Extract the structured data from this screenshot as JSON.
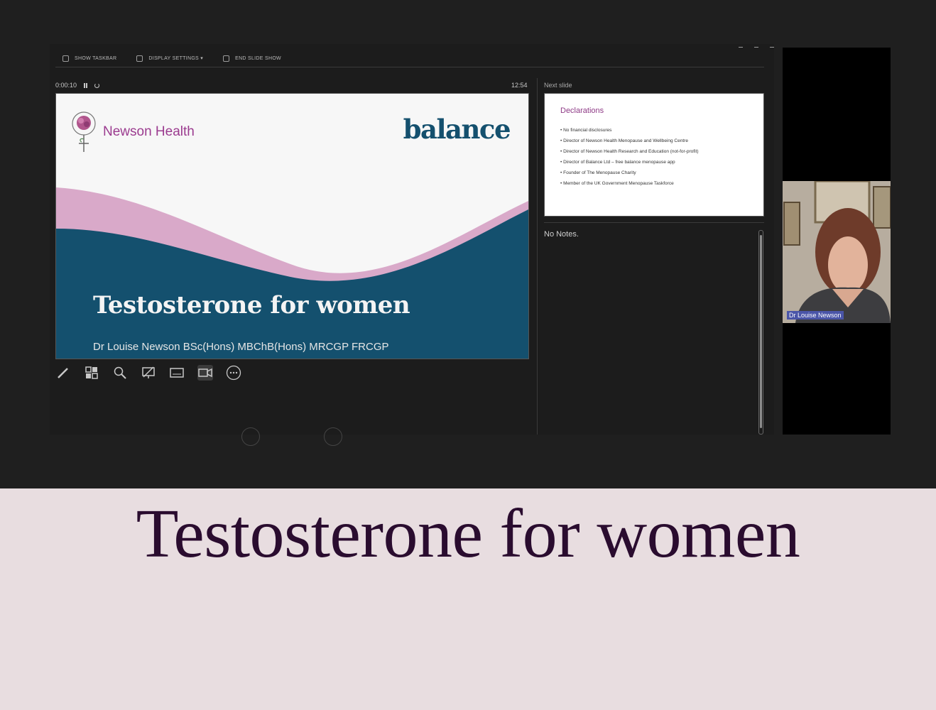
{
  "toolbar": {
    "items": [
      "SHOW TASKBAR",
      "DISPLAY SETTINGS ▾",
      "END SLIDE SHOW"
    ]
  },
  "timer": {
    "elapsed": "0:00:10",
    "clock": "12:54"
  },
  "current_slide": {
    "org_name": "Newson Health",
    "brand": "balance",
    "title": "Testosterone for women",
    "author": "Dr Louise Newson BSc(Hons) MBChB(Hons) MRCGP FRCGP"
  },
  "next_slide": {
    "label": "Next slide",
    "title": "Declarations",
    "items": [
      "No financial disclosures",
      "Director of Newson Health Menopause and Wellbeing Centre",
      "Director of Newson Health Research and Education (not-for-profit)",
      "Director of Balance Ltd – free balance menopause app",
      "Founder of The Menopause Charity",
      "Member of the UK Government Menopause Taskforce"
    ]
  },
  "notes": "No Notes.",
  "camera": {
    "name": "Dr Louise Newson"
  },
  "caption": "Testosterone for women",
  "colors": {
    "brand_purple": "#9b3b8f",
    "brand_teal": "#14506e",
    "wave_pink": "#d9a9c9",
    "caption_bg": "#e8dde0",
    "caption_text": "#2a0c2f"
  }
}
